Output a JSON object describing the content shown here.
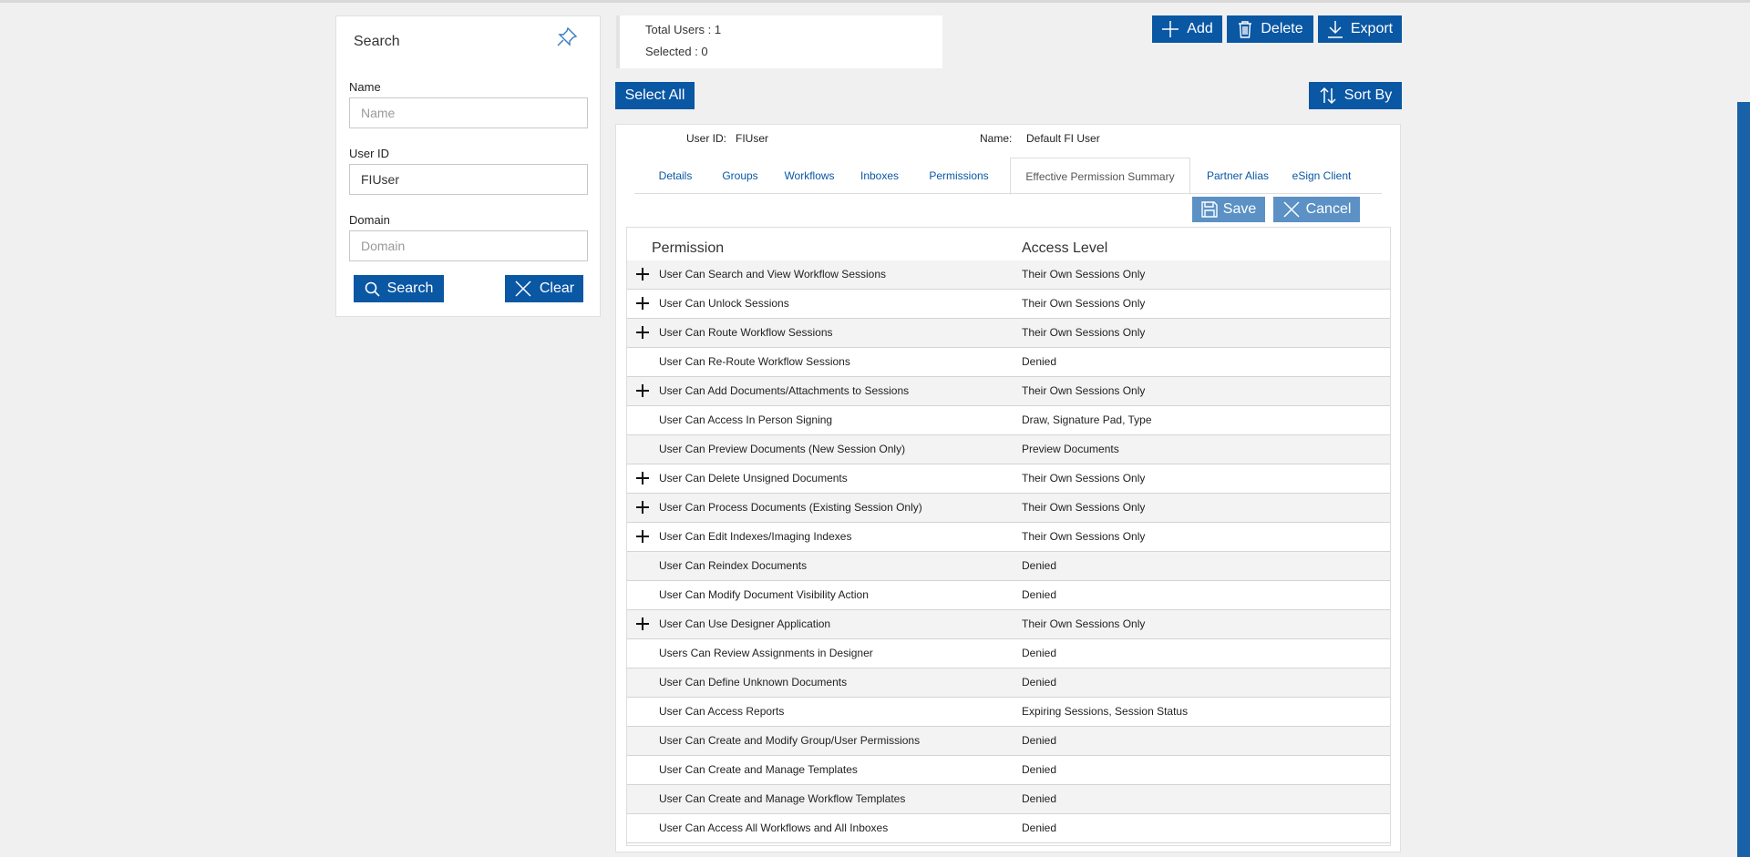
{
  "search": {
    "title": "Search",
    "name_label": "Name",
    "name_placeholder": "Name",
    "name_value": "",
    "userid_label": "User ID",
    "userid_value": "FIUser",
    "domain_label": "Domain",
    "domain_placeholder": "Domain",
    "domain_value": "",
    "search_button": "Search",
    "clear_button": "Clear"
  },
  "info": {
    "total_users": "Total Users : 1",
    "selected": "Selected : 0"
  },
  "toolbar": {
    "add": "Add",
    "delete": "Delete",
    "export": "Export",
    "select_all": "Select All",
    "sort_by": "Sort By"
  },
  "user": {
    "userid_label": "User ID:",
    "userid_value": "FIUser",
    "name_label": "Name:",
    "name_value": "Default FI User"
  },
  "tabs": [
    {
      "label": "Details"
    },
    {
      "label": "Groups"
    },
    {
      "label": "Workflows"
    },
    {
      "label": "Inboxes"
    },
    {
      "label": "Permissions"
    },
    {
      "label": "Effective Permission Summary",
      "active": true
    },
    {
      "label": "Partner Alias"
    },
    {
      "label": "eSign Client"
    }
  ],
  "actions": {
    "save": "Save",
    "cancel": "Cancel"
  },
  "grid": {
    "col_permission": "Permission",
    "col_access": "Access Level",
    "rows": [
      {
        "permission": "User Can Search and View Workflow Sessions",
        "access": "Their Own Sessions Only",
        "expandable": true
      },
      {
        "permission": "User Can Unlock Sessions",
        "access": "Their Own Sessions Only",
        "expandable": true
      },
      {
        "permission": "User Can Route Workflow Sessions",
        "access": "Their Own Sessions Only",
        "expandable": true
      },
      {
        "permission": "User Can Re-Route Workflow Sessions",
        "access": "Denied",
        "expandable": false
      },
      {
        "permission": "User Can Add Documents/Attachments to Sessions",
        "access": "Their Own Sessions Only",
        "expandable": true
      },
      {
        "permission": "User Can Access In Person Signing",
        "access": "Draw, Signature Pad, Type",
        "expandable": false
      },
      {
        "permission": "User Can Preview Documents (New Session Only)",
        "access": "Preview Documents",
        "expandable": false
      },
      {
        "permission": "User Can Delete Unsigned Documents",
        "access": "Their Own Sessions Only",
        "expandable": true
      },
      {
        "permission": "User Can Process Documents (Existing Session Only)",
        "access": "Their Own Sessions Only",
        "expandable": true
      },
      {
        "permission": "User Can Edit Indexes/Imaging Indexes",
        "access": "Their Own Sessions Only",
        "expandable": true
      },
      {
        "permission": "User Can Reindex Documents",
        "access": "Denied",
        "expandable": false
      },
      {
        "permission": "User Can Modify Document Visibility Action",
        "access": "Denied",
        "expandable": false
      },
      {
        "permission": "User Can Use Designer Application",
        "access": "Their Own Sessions Only",
        "expandable": true
      },
      {
        "permission": "Users Can Review Assignments in Designer",
        "access": "Denied",
        "expandable": false
      },
      {
        "permission": "User Can Define Unknown Documents",
        "access": "Denied",
        "expandable": false
      },
      {
        "permission": "User Can Access Reports",
        "access": "Expiring Sessions, Session Status",
        "expandable": false
      },
      {
        "permission": "User Can Create and Modify Group/User Permissions",
        "access": "Denied",
        "expandable": false
      },
      {
        "permission": "User Can Create and Manage Templates",
        "access": "Denied",
        "expandable": false
      },
      {
        "permission": "User Can Create and Manage Workflow Templates",
        "access": "Denied",
        "expandable": false
      },
      {
        "permission": "User Can Access All Workflows and All Inboxes",
        "access": "Denied",
        "expandable": false
      }
    ]
  },
  "colors": {
    "primary": "#0a57a4",
    "light_button": "#5b91c4",
    "background": "#f0f0f0"
  }
}
